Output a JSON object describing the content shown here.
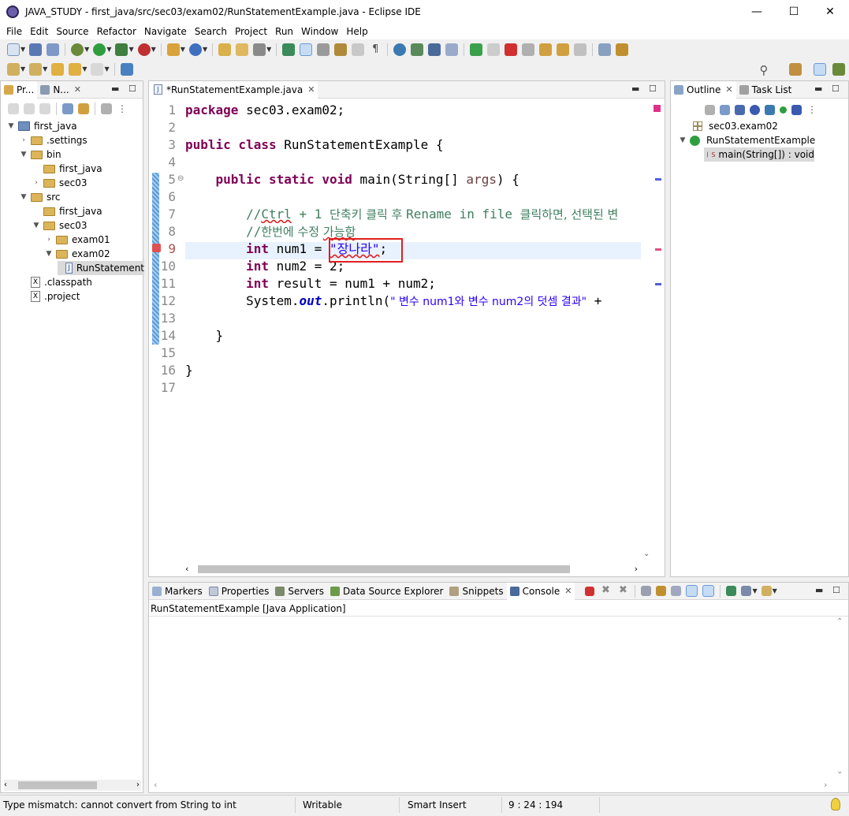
{
  "window": {
    "title": "JAVA_STUDY - first_java/src/sec03/exam02/RunStatementExample.java - Eclipse IDE",
    "minimize": "—",
    "maximize": "☐",
    "close": "✕"
  },
  "menu": [
    "File",
    "Edit",
    "Source",
    "Refactor",
    "Navigate",
    "Search",
    "Project",
    "Run",
    "Window",
    "Help"
  ],
  "left_panel": {
    "tabs": [
      "Pr...",
      "N..."
    ],
    "tree": [
      "first_java",
      ".settings",
      "bin",
      "first_java",
      "sec03",
      "src",
      "first_java",
      "sec03",
      "exam01",
      "exam02",
      "RunStatement",
      ".classpath",
      ".project"
    ]
  },
  "editor": {
    "tab_label": "*RunStatementExample.java",
    "lines": [
      "1",
      "2",
      "3",
      "4",
      "5",
      "6",
      "7",
      "8",
      "9",
      "10",
      "11",
      "12",
      "13",
      "14",
      "15",
      "16",
      "17"
    ],
    "code": {
      "l1_kw": "package",
      "l1_rest": " sec03.exam02;",
      "l3_kw": "public class",
      "l3_rest": " RunStatementExample {",
      "l5_indent": "    ",
      "l5_kw": "public static void",
      "l5_rest": " main(String[] ",
      "l5_arg": "args",
      "l5_end": ") {",
      "l7_indent": "        ",
      "l7_c1": "//",
      "l7_ctrl": "Ctrl",
      "l7_c2": " + 1 ",
      "l7_k1": "단축키 클릭 후 ",
      "l7_c3": "Rename in file ",
      "l7_k2": "클릭하면, 선택된 변",
      "l8_indent": "        ",
      "l8_c1": "//",
      "l8_k1": "한번에 수정 ",
      "l8_k2": "가능함",
      "l9_indent": "        ",
      "l9_kw": "int",
      "l9_mid": " num1 = ",
      "l9_str": "\"장나라\"",
      "l9_end": ";",
      "l10_indent": "        ",
      "l10_kw": "int",
      "l10_rest": " num2 = 2;",
      "l11_indent": "        ",
      "l11_kw": "int",
      "l11_rest": " result = num1 + num2;",
      "l12_indent": "        ",
      "l12_a": "System.",
      "l12_out": "out",
      "l12_b": ".println(",
      "l12_str": "\" 변수 num1와 변수 num2의 덧셈 결과\"",
      "l12_end": " +",
      "l14_indent": "    ",
      "l14_txt": "}",
      "l16_txt": "}"
    }
  },
  "outline": {
    "tabs": [
      "Outline",
      "Task List"
    ],
    "items": [
      "sec03.exam02",
      "RunStatementExample",
      "main(String[]) : void"
    ],
    "static_mark": "S"
  },
  "bottom": {
    "tabs": [
      "Markers",
      "Properties",
      "Servers",
      "Data Source Explorer",
      "Snippets",
      "Console"
    ],
    "console_header": "RunStatementExample [Java Application]"
  },
  "status": {
    "message": "Type mismatch: cannot convert from String to int",
    "writable": "Writable",
    "insert_mode": "Smart Insert",
    "position": "9 : 24 : 194"
  },
  "colors": {
    "highlight_box": "#e02020",
    "current_line": "#e8f2fe",
    "selected_item": "#cfe3f7"
  }
}
